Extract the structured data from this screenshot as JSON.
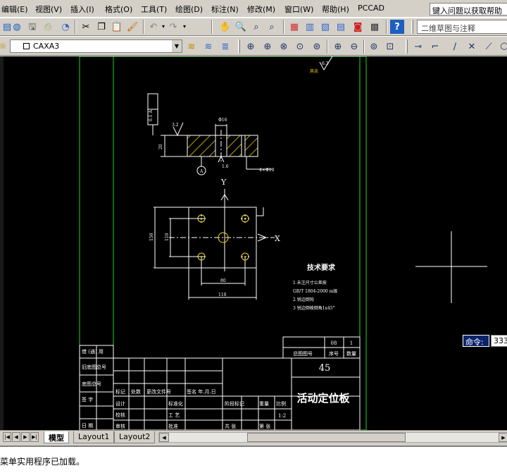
{
  "menubar": {
    "items": [
      "编辑(E)",
      "视图(V)",
      "插入(I)",
      "格式(O)",
      "工具(T)",
      "绘图(D)",
      "标注(N)",
      "修改(M)",
      "窗口(W)",
      "帮助(H)",
      "PCCAD"
    ],
    "help_box": "键入问题以获取帮助"
  },
  "toolbar": {
    "sketch_combo": "二维草图与注释",
    "layer_name": "CAXA3",
    "icons_standard": [
      "new-icon",
      "open-icon",
      "save-icon",
      "print-icon",
      "cut-icon",
      "copy-icon",
      "paste-icon",
      "match-properties-icon",
      "undo-icon",
      "redo-icon",
      "pan-icon",
      "zoom-realtime-icon",
      "zoom-window-icon",
      "zoom-previous-icon",
      "properties-icon",
      "design-center-icon",
      "tool-palette-icon",
      "markup-icon",
      "calculator-icon",
      "help-icon"
    ],
    "icons_layer": [
      "layer-manager-icon",
      "layer-previous-icon",
      "layer-state-icon"
    ],
    "icons_zoom": [
      "zoom-window-icon",
      "zoom-dynamic-icon",
      "zoom-scale-icon",
      "zoom-center-icon",
      "zoom-object-icon",
      "zoom-in-icon",
      "zoom-out-icon",
      "zoom-all-icon",
      "zoom-extents-icon"
    ],
    "icons_draw": [
      "ucs-icon",
      "ucs-origin-icon",
      "line-icon",
      "construction-line-icon",
      "polyline-icon"
    ]
  },
  "drawing": {
    "roughness_top": "6.3",
    "roughness_top_note": "其余",
    "roughness_side": "3.2",
    "roughness_bottom": "1.6",
    "tolerance_frame": "0.1 A",
    "tolerance_hole": "4×Φ10",
    "dim_thickness": "20",
    "dim_slot": "Φ16",
    "axis_y": "Y",
    "axis_x": "X",
    "dim_height": "150",
    "dim_inner_height": "110",
    "dim_inner_width": "80",
    "dim_width": "110",
    "datum": "A",
    "tech_req_title": "技术要求",
    "tech_req_lines": [
      "1 未注尺寸公差按",
      "GB/T 1804-2000 m级",
      "2 锐边倒钝",
      "3 锐边倒棱倒角1x45°"
    ],
    "title_block": {
      "material": "45",
      "part_name": "活动定位板",
      "scale": "1:2",
      "left_rows": [
        "借 (通) 用",
        "旧底图总号",
        "底图总号",
        "签 字",
        "日 期"
      ],
      "label_marks": "标记",
      "label_count": "处数",
      "label_change_doc": "更改文件号",
      "label_sign_date": "签名 年.月.日",
      "label_design": "设计",
      "label_standardize": "标准化",
      "label_check": "校核",
      "label_process": "工 艺",
      "label_review": "审核",
      "label_approve": "批准",
      "label_stage": "阶段标记",
      "label_weight": "重量",
      "label_ratio": "比例",
      "label_total": "共 张",
      "label_sheet": "第 张",
      "parts_header": "总图图号",
      "parts_seq": "序号",
      "parts_qty": "数量",
      "parts_no": "08",
      "parts_count": "1"
    }
  },
  "command": {
    "label": "命令:",
    "value": "333",
    "history": "菜单实用程序已加载。"
  },
  "tabs": [
    "模型",
    "Layout1",
    "Layout2"
  ]
}
